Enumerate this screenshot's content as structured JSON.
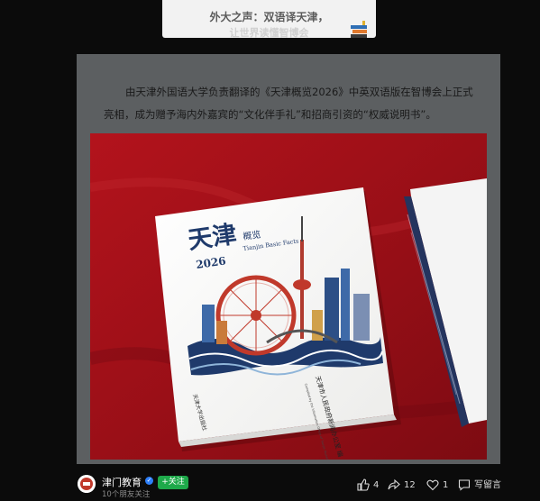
{
  "banner": {
    "title": "外大之声：双语译天津，",
    "subtitle": "让世界读懂智博会"
  },
  "article": {
    "paragraph": "由天津外国语大学负责翻译的《天津概览2026》中英双语版在智博会上正式亮相，成为赠予海内外嘉宾的“文化伴手礼”和招商引资的“权威说明书”。"
  },
  "book": {
    "title_cn": "天津",
    "title_cn_small": "概览",
    "title_en": "Tianjin Basic Facts",
    "year": "2026",
    "editor": "天津市人民政府新闻办公室 编",
    "compiled": "Compiled by the Information Office of Tianjin Municipal People's Government",
    "publisher": "天津大学出版社"
  },
  "account": {
    "name": "津门教育",
    "follow_label": "+关注",
    "followers": "10个朋友关注"
  },
  "actions": {
    "like_count": "4",
    "share_count": "12",
    "favorite_count": "1",
    "comment_label": "写留言"
  },
  "colors": {
    "background": "#0b0b0b",
    "card": "#5c5f61",
    "tablecloth": "#9c1218",
    "follow": "#1ea94a",
    "verified": "#2d7ff9"
  }
}
